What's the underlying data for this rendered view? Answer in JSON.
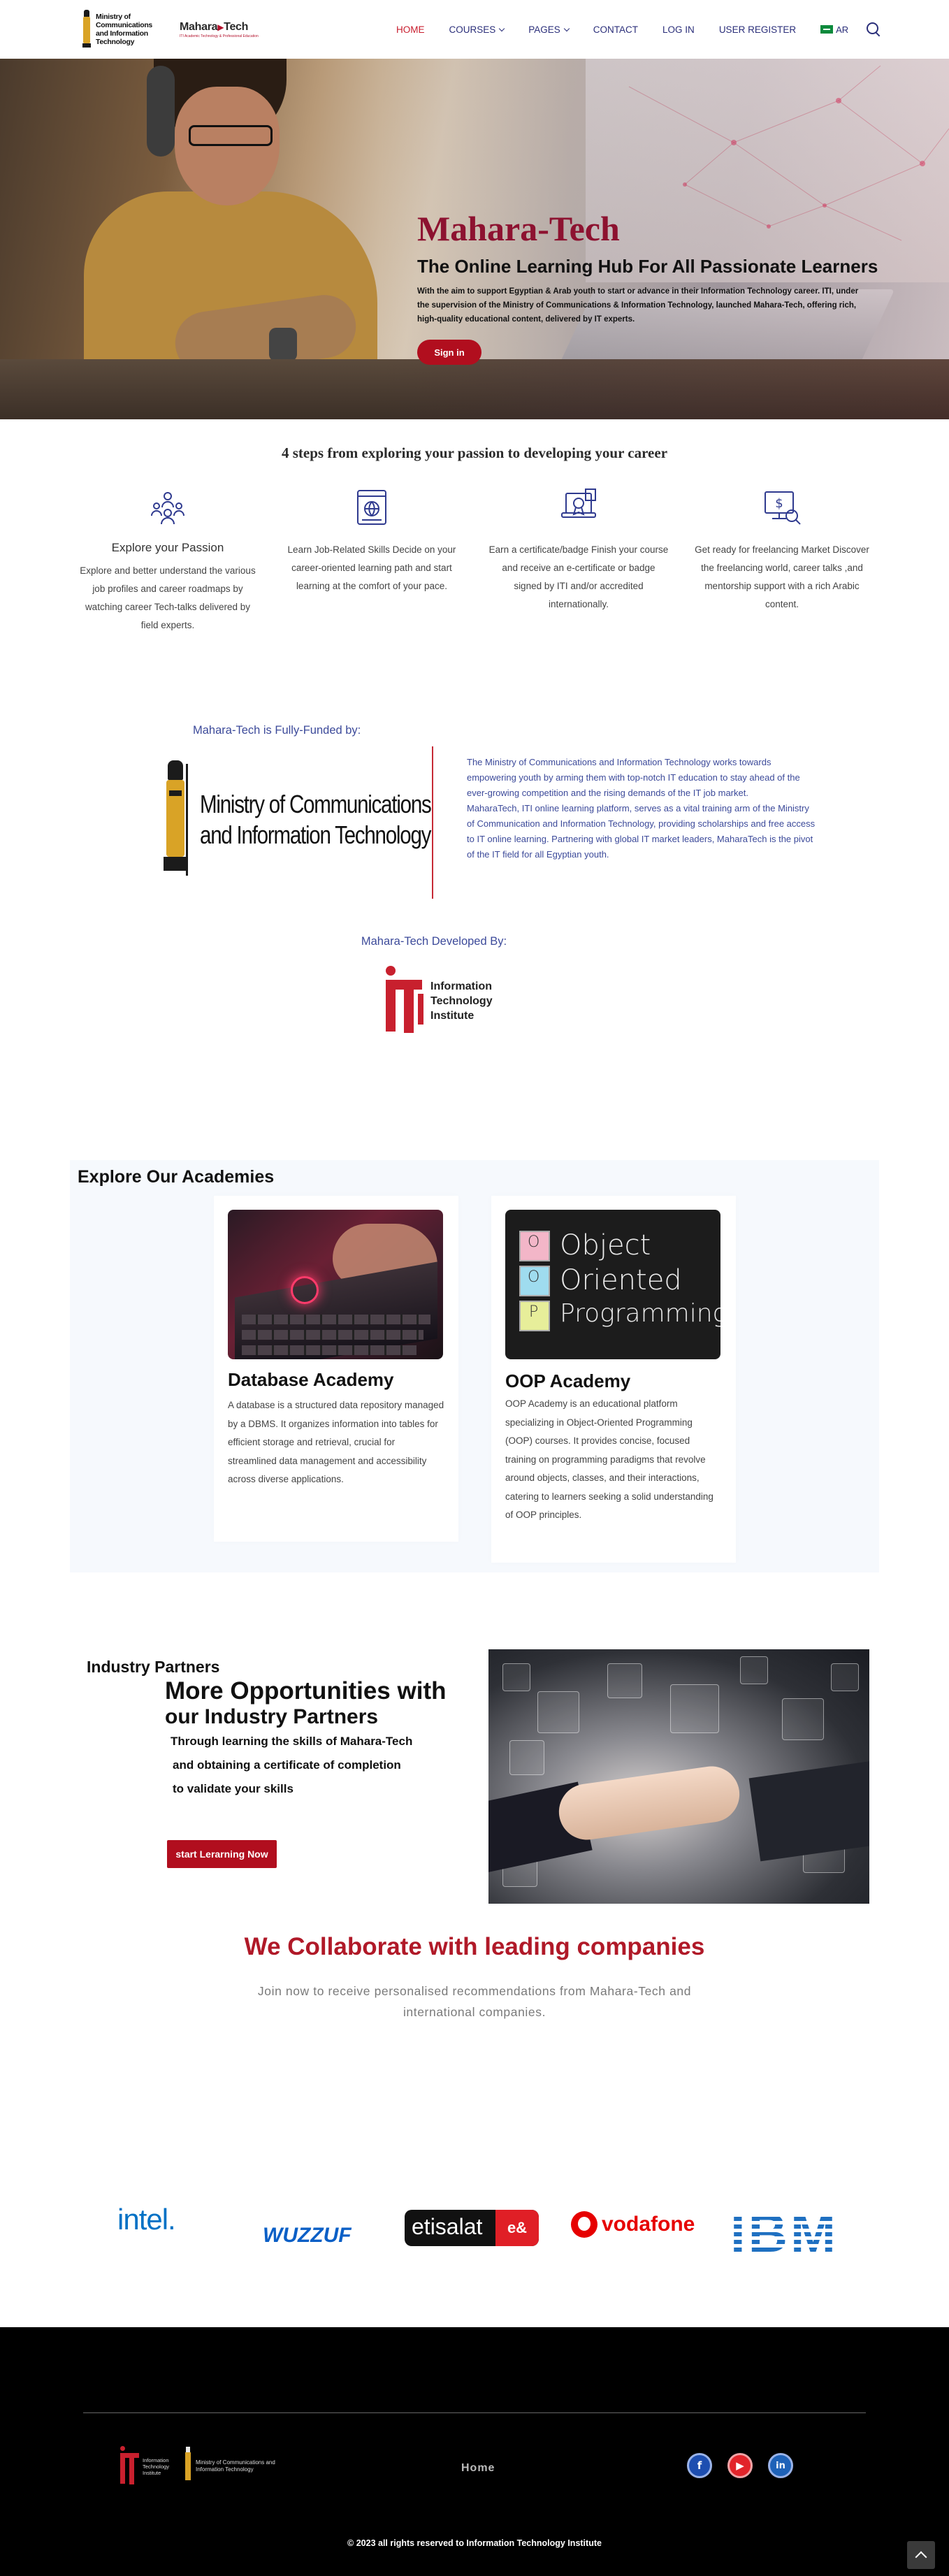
{
  "header": {
    "ministry_logo_text": "Ministry of Communications and Information Technology",
    "brand_name": "Mahara",
    "brand_name_suffix": "Tech",
    "brand_tagline": "ITI Academic Technology & Professional Education",
    "menu": {
      "home": "HOME",
      "courses": "COURSES",
      "pages": "PAGES",
      "contact": "CONTACT",
      "login": "LOG IN",
      "register": "USER REGISTER",
      "lang": "AR"
    }
  },
  "hero": {
    "title": "Mahara-Tech",
    "subtitle": "The Online Learning Hub For All Passionate Learners",
    "description": "With the aim to support Egyptian & Arab youth to start or advance in their Information Technology career. ITI, under the supervision of the Ministry of Communications & Information Technology, launched Mahara-Tech, offering rich, high-quality educational content, delivered by IT experts.",
    "signin": "Sign in"
  },
  "steps": {
    "title": "4 steps from exploring your passion to developing your career",
    "items": [
      {
        "heading": "Explore your Passion",
        "text": "Explore and better understand the various job profiles and career roadmaps by watching career Tech-talks delivered by field experts."
      },
      {
        "heading": "",
        "text": "Learn Job-Related Skills Decide on your career-oriented learning path and start learning at the comfort of your pace."
      },
      {
        "heading": "",
        "text": "Earn a certificate/badge Finish your course and receive an e-certificate or badge signed by ITI and/or accredited internationally."
      },
      {
        "heading": "",
        "text": "Get ready for freelancing Market Discover the freelancing world, career talks ,and mentorship support with a rich Arabic content."
      }
    ]
  },
  "funded": {
    "label": "Mahara-Tech is Fully-Funded by:",
    "ministry_line1": "Ministry of Communications",
    "ministry_line2": "and Information Technology",
    "para1": "The Ministry of Communications and Information Technology works towards empowering youth by arming them with top-notch IT education to stay ahead of the ever-growing competition and the rising demands of the IT job market.",
    "para2": "MaharaTech, ITI online learning platform, serves as a vital training arm of the Ministry of Communication and Information Technology, providing scholarships and free access to IT online learning. Partnering with global IT market leaders, MaharaTech is the pivot of the IT field for all Egyptian youth.",
    "dev_label": "Mahara-Tech Developed By:",
    "iti_line1": "Information",
    "iti_line2": "Technology",
    "iti_line3": "Institute"
  },
  "academies": {
    "title": "Explore Our Academies",
    "cards": [
      {
        "title": "Database Academy",
        "text": "A database is a structured data repository managed by a DBMS. It organizes information into tables for efficient storage and retrieval, crucial for streamlined data management and accessibility across diverse applications."
      },
      {
        "title": "OOP Academy",
        "text": "OOP Academy is an educational platform specializing in Object-Oriented Programming (OOP) courses. It provides concise, focused training on programming paradigms that revolve around objects, classes, and their interactions, catering to learners seeking a solid understanding of OOP principles.",
        "img_letters": [
          "O",
          "O",
          "P"
        ],
        "img_words": [
          "Object",
          "Oriented",
          "Programming"
        ]
      }
    ]
  },
  "partners": {
    "label": "Industry Partners",
    "h1": "More Opportunities with",
    "h2": "our Industry Partners",
    "p1": "Through learning the skills of Mahara-Tech",
    "p2": "and obtaining a certificate of completion",
    "p3": "to validate your skills",
    "cta": "start Lerarning Now"
  },
  "collab": {
    "title": "We Collaborate with leading companies",
    "subtitle": "Join now to receive personalised recommendations from Mahara-Tech and international companies.",
    "companies": {
      "intel": "intel.",
      "wuzzuf": "WUZZUF",
      "etisalat": "etisalat",
      "etisalat_badge": "e&",
      "vodafone": "vodafone",
      "ibm": "IBM"
    }
  },
  "footer": {
    "iti_text": "Information Technology Institute",
    "ministry_text": "Ministry of Communications and Information Technology",
    "home": "Home",
    "copyright": "© 2023 all rights reserved to Information Technology Institute"
  },
  "colors": {
    "brand_red": "#b10e1e",
    "title_maroon": "#8d1230",
    "nav_blue": "#2b2f7a",
    "funded_blue": "#3c4a9a"
  },
  "icons": [
    "search-icon",
    "saudi-flag-icon",
    "team-icon",
    "web-course-icon",
    "certificate-icon",
    "freelance-icon",
    "facebook-icon",
    "youtube-icon",
    "linkedin-icon",
    "back-to-top-icon"
  ]
}
